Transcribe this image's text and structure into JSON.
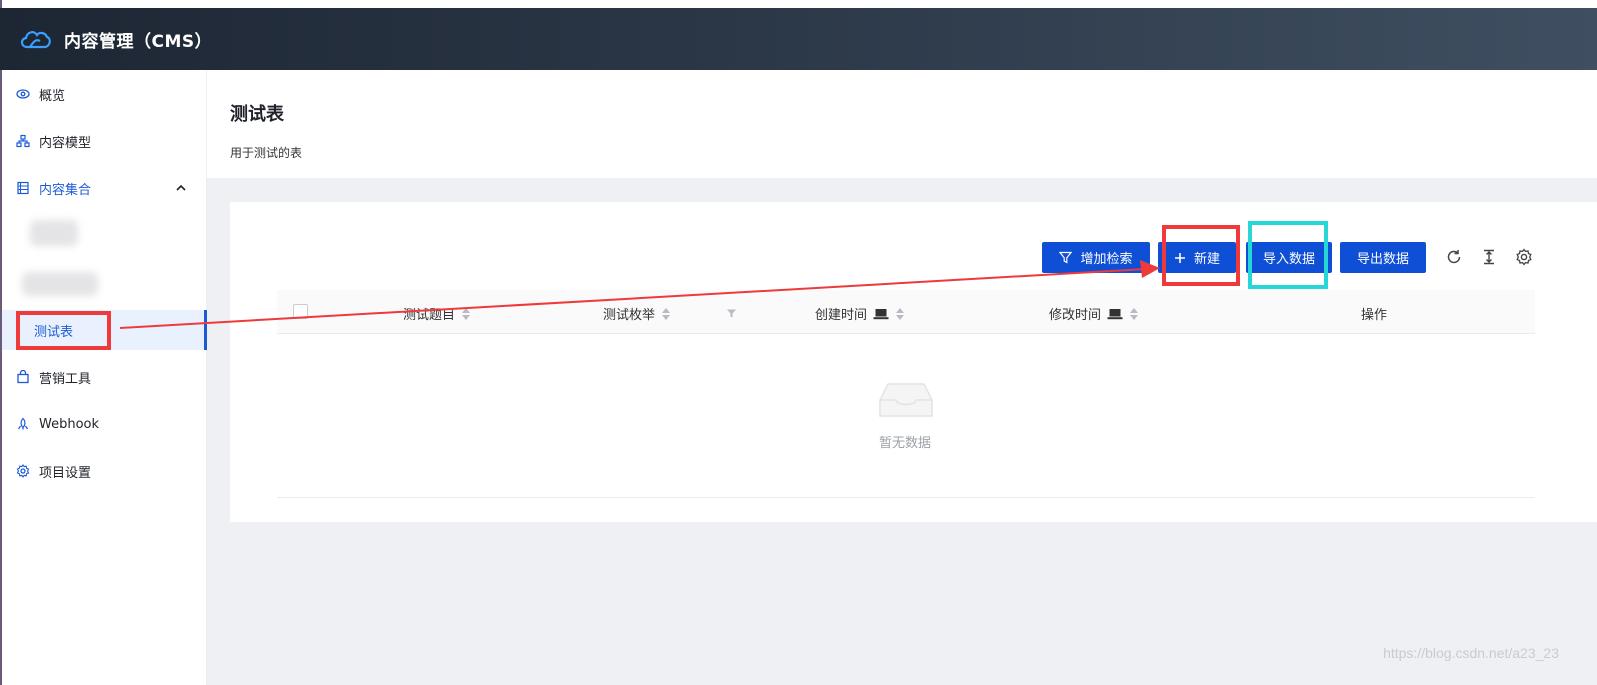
{
  "app": {
    "title": "内容管理（CMS）"
  },
  "sidebar": {
    "items": [
      {
        "label": "概览",
        "icon": "eye-icon"
      },
      {
        "label": "内容模型",
        "icon": "hierarchy-icon"
      },
      {
        "label": "内容集合",
        "icon": "collection-icon"
      },
      {
        "label": "测试表"
      },
      {
        "label": "营销工具",
        "icon": "bag-icon"
      },
      {
        "label": "Webhook",
        "icon": "webhook-icon"
      },
      {
        "label": "项目设置",
        "icon": "gear-icon"
      }
    ]
  },
  "page": {
    "title": "测试表",
    "description": "用于测试的表"
  },
  "toolbar": {
    "search_label": "增加检索",
    "create_label": "新建",
    "import_label": "导入数据",
    "export_label": "导出数据"
  },
  "table": {
    "columns": [
      "测试题目",
      "测试枚举",
      "创建时间",
      "修改时间",
      "操作"
    ],
    "empty_text": "暂无数据"
  },
  "watermark": "https://blog.csdn.net/a23_23",
  "colors": {
    "accent": "#0f4fd6",
    "annotation_red": "#ee3a3a",
    "annotation_cyan": "#27d7d7"
  }
}
